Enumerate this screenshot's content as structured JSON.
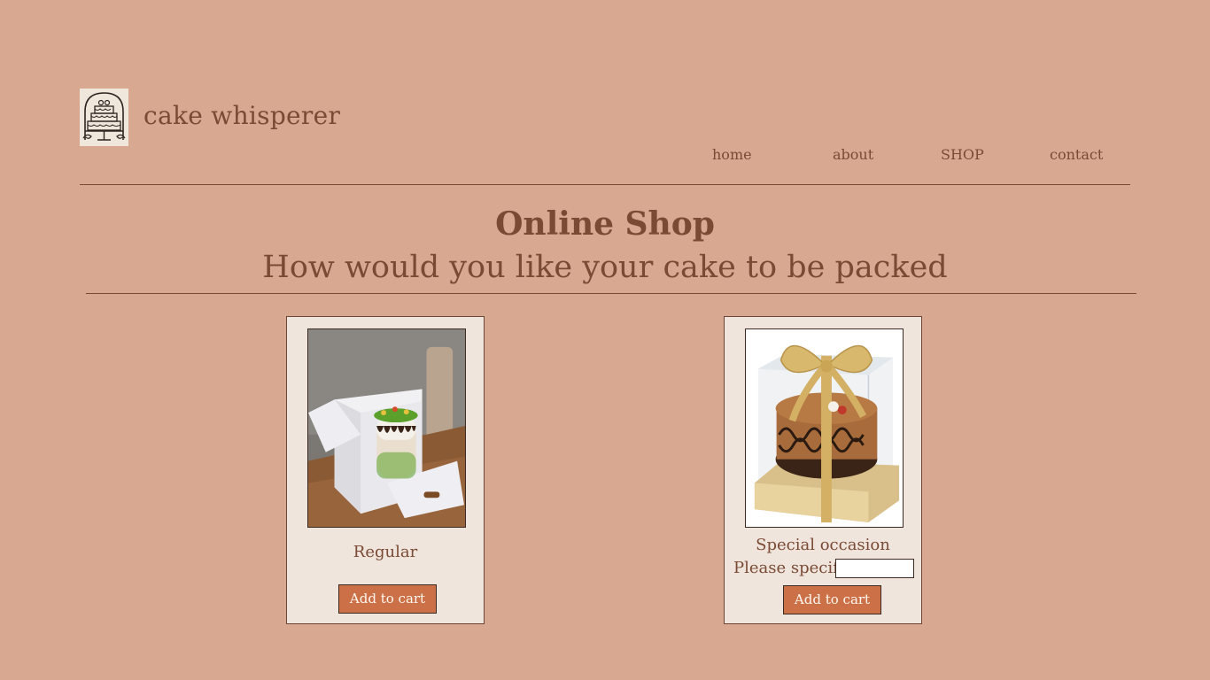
{
  "header": {
    "brand": "cake whisperer",
    "logo_icon": "tiered-cake-logo-icon"
  },
  "nav": {
    "items": [
      {
        "label": "home"
      },
      {
        "label": "about"
      },
      {
        "label": "SHOP"
      },
      {
        "label": "contact"
      }
    ]
  },
  "main": {
    "title": "Online Shop",
    "subtitle": "How would you like your cake to be packed"
  },
  "products": [
    {
      "name": "Regular",
      "image_icon": "cake-in-white-box-image",
      "button_label": "Add to cart"
    },
    {
      "name": "Special occasion",
      "image_icon": "cake-in-clear-box-with-ribbon-image",
      "specify_label": "Please specify:",
      "specify_value": "",
      "specify_placeholder": "",
      "button_label": "Add to cart"
    }
  ],
  "colors": {
    "background": "#d8a890",
    "text": "#7a4a35",
    "card": "#f0e5dc",
    "button": "#cc7048"
  }
}
